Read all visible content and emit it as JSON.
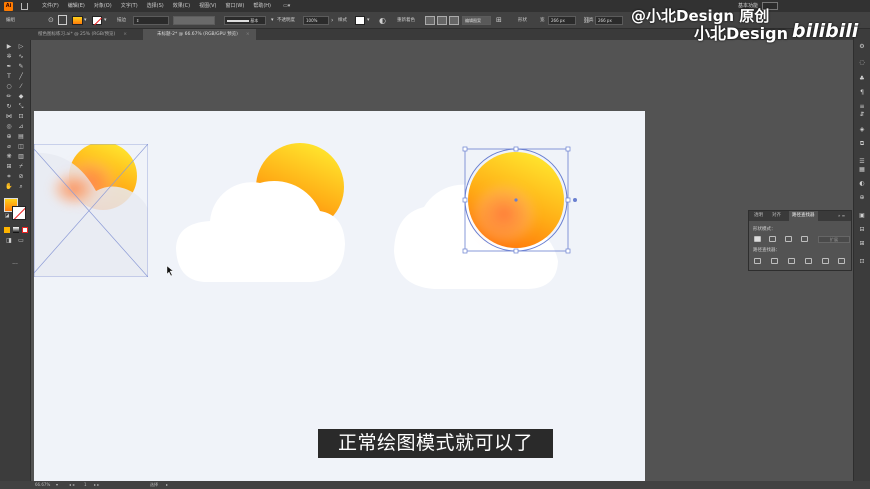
{
  "menubar": {
    "items": [
      "文件(F)",
      "编辑(E)",
      "对象(O)",
      "文字(T)",
      "选择(S)",
      "效果(C)",
      "视图(V)",
      "窗口(W)",
      "帮助(H)"
    ],
    "workspace": "基本功能"
  },
  "control_bar": {
    "selection_label": "编组",
    "stroke_label": "描边",
    "brush_label": "基本",
    "opacity_label": "不透明度",
    "opacity_value": "100%",
    "style_label": "样式",
    "rearrange_label": "重新着色",
    "edit_label": "编辑图案",
    "shape_label": "形状",
    "width_label": "宽",
    "width_value": "266 px",
    "height_label": "高",
    "height_value": "266 px",
    "fill_color": "#ff9a1a"
  },
  "tabs": [
    {
      "label": "橙色图标练习.ai* @ 25% (RGB/预览)",
      "active": false
    },
    {
      "label": "未标题-2* @ 66.67% (RGB/GPU 预览)",
      "active": true
    }
  ],
  "watermark": {
    "line1": "@小北Design  原创",
    "line2": "小北Design",
    "brand": "bilibili"
  },
  "subtitle": "正常绘图模式就可以了",
  "statusbar": {
    "zoom": "66.67%",
    "page": "1",
    "tool": "选择"
  },
  "pathfinder_panel": {
    "tabs": [
      "透明",
      "对齐",
      "路径查找器"
    ],
    "shape_modes_label": "形状模式：",
    "expand_label": "扩展",
    "pathfinders_label": "路径查找器："
  },
  "colors": {
    "artboard": "#f0f3f9",
    "sun_top": "#ffe02a",
    "sun_bottom": "#ff7a0a",
    "selection": "#6a7fd0"
  }
}
